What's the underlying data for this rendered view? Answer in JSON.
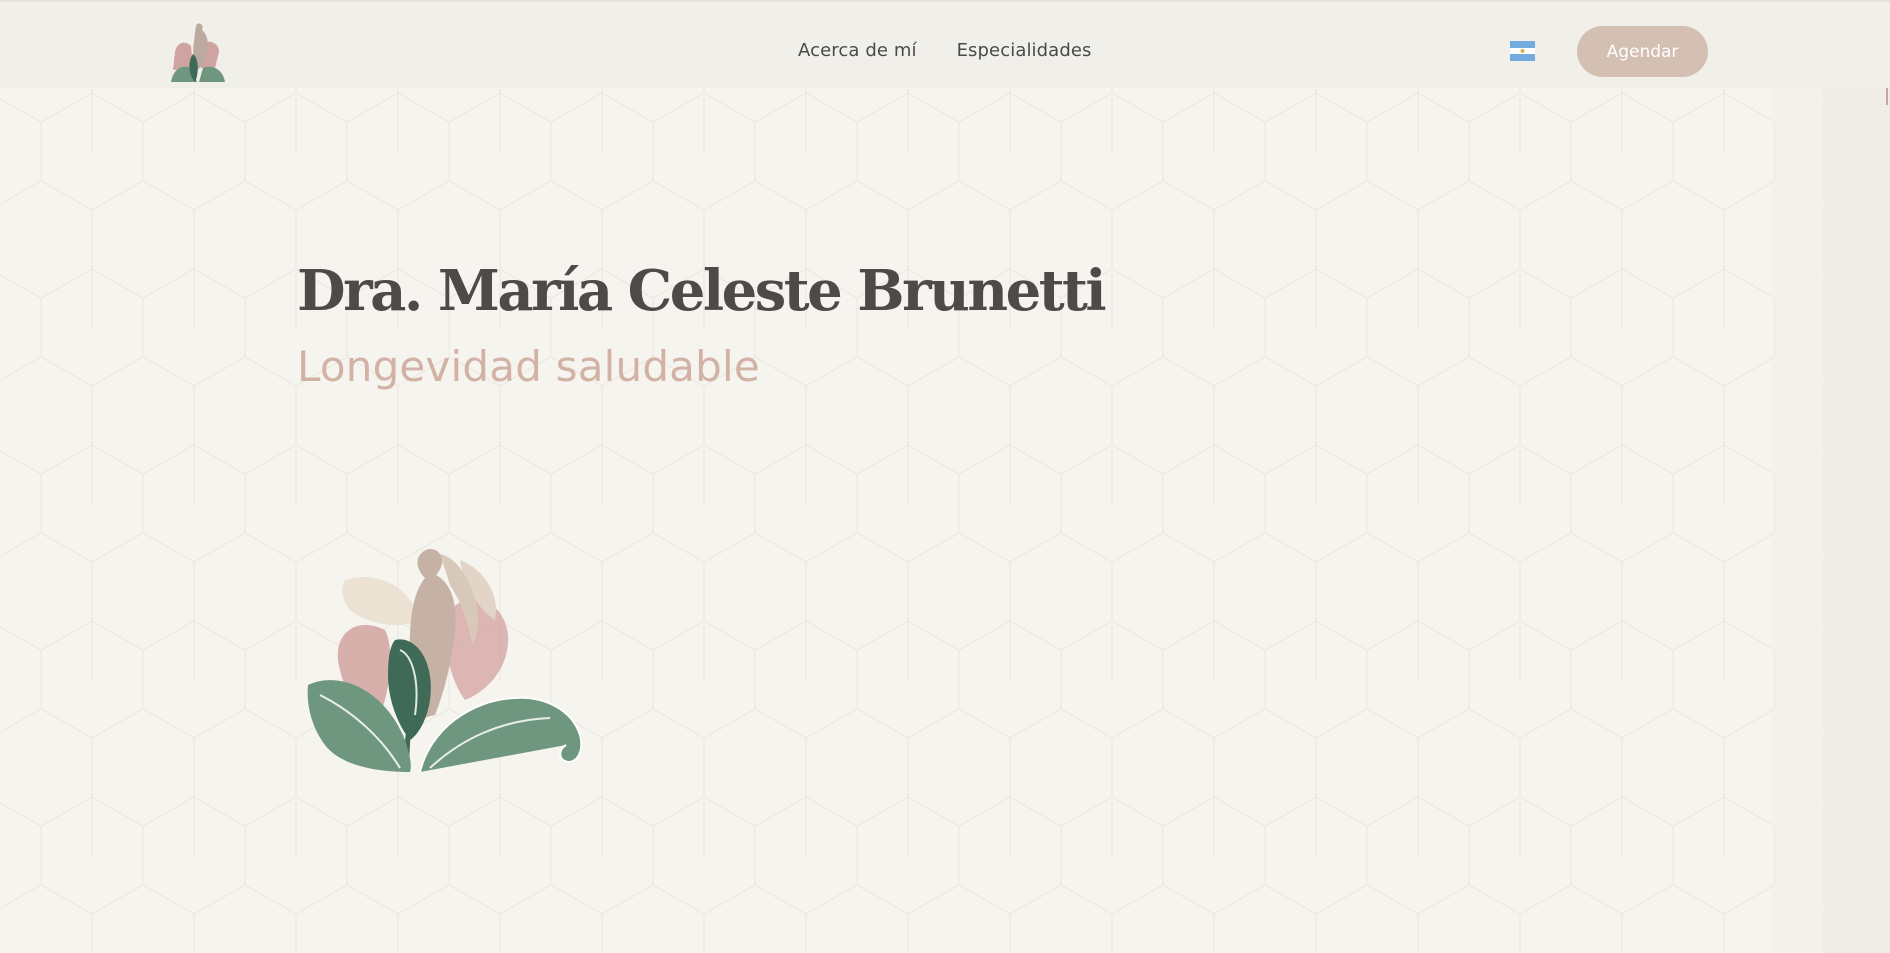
{
  "header": {
    "nav": [
      {
        "label": "Acerca de mí"
      },
      {
        "label": "Especialidades"
      }
    ],
    "language_flag": "argentina-flag-icon",
    "cta_label": "Agendar"
  },
  "hero": {
    "title": "Dra. María Celeste Brunetti",
    "subtitle": "Longevidad saludable"
  },
  "colors": {
    "background": "#f6f4ef",
    "title": "#4d4b4a",
    "subtitle": "#d3b2a6",
    "cta": "#d4bfb3",
    "leaf_green": "#5f8b77",
    "petal_pink": "#cfa3a0"
  }
}
